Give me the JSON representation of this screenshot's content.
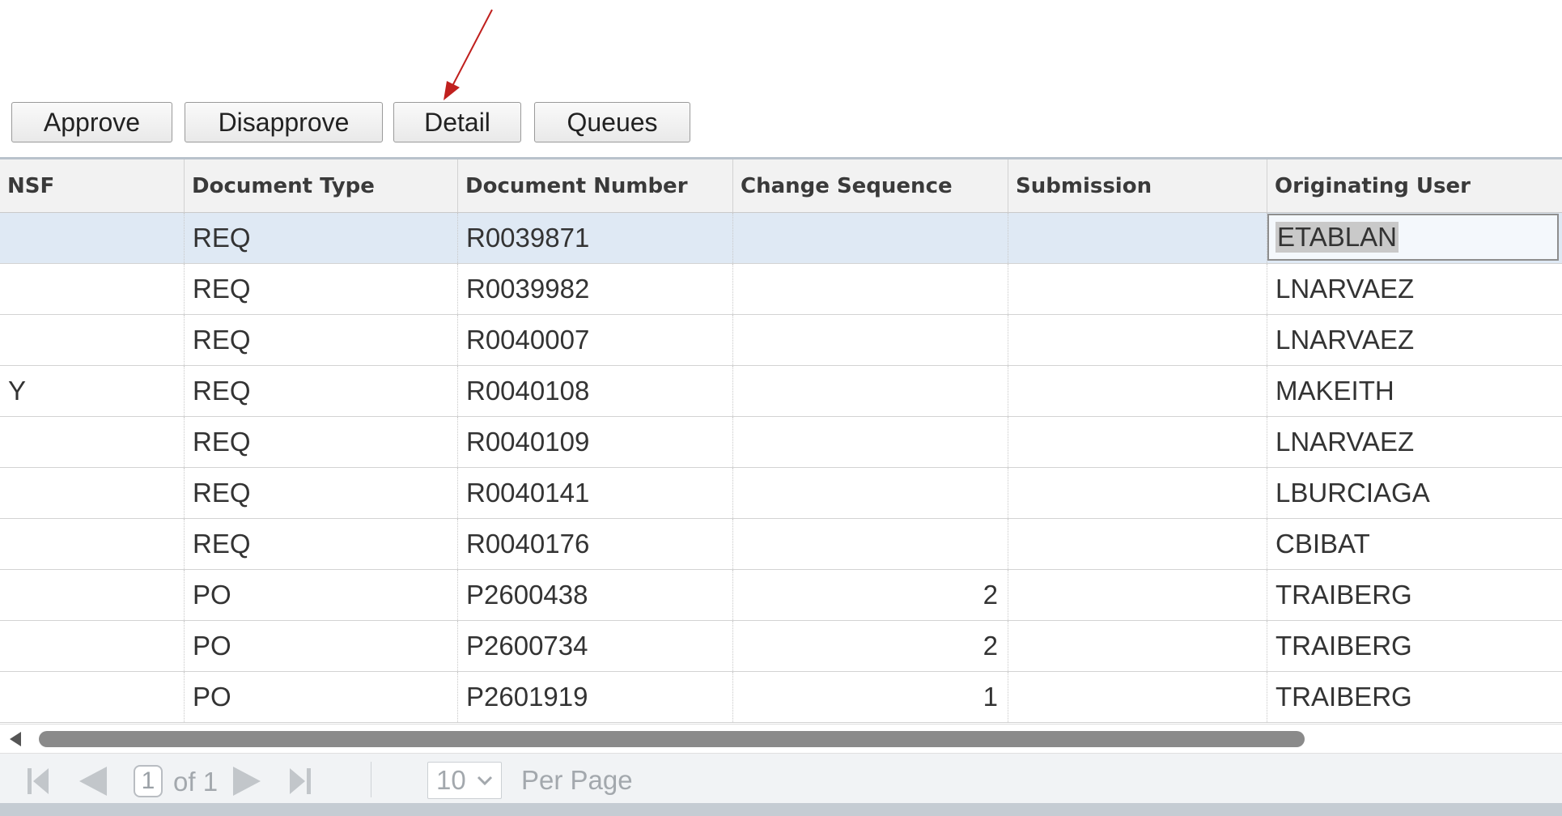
{
  "toolbar": {
    "buttons": [
      {
        "label": "Approve"
      },
      {
        "label": "Disapprove"
      },
      {
        "label": "Detail"
      },
      {
        "label": "Queues"
      }
    ]
  },
  "grid": {
    "columns": [
      "NSF",
      "Document Type",
      "Document Number",
      "Change Sequence",
      "Submission",
      "Originating User"
    ],
    "rows": [
      {
        "nsf": "",
        "doc_type": "REQ",
        "doc_number": "R0039871",
        "change_seq": "",
        "submission": "",
        "user": "ETABLAN",
        "selected": true
      },
      {
        "nsf": "",
        "doc_type": "REQ",
        "doc_number": "R0039982",
        "change_seq": "",
        "submission": "",
        "user": "LNARVAEZ"
      },
      {
        "nsf": "",
        "doc_type": "REQ",
        "doc_number": "R0040007",
        "change_seq": "",
        "submission": "",
        "user": "LNARVAEZ"
      },
      {
        "nsf": "Y",
        "doc_type": "REQ",
        "doc_number": "R0040108",
        "change_seq": "",
        "submission": "",
        "user": "MAKEITH"
      },
      {
        "nsf": "",
        "doc_type": "REQ",
        "doc_number": "R0040109",
        "change_seq": "",
        "submission": "",
        "user": "LNARVAEZ"
      },
      {
        "nsf": "",
        "doc_type": "REQ",
        "doc_number": "R0040141",
        "change_seq": "",
        "submission": "",
        "user": "LBURCIAGA"
      },
      {
        "nsf": "",
        "doc_type": "REQ",
        "doc_number": "R0040176",
        "change_seq": "",
        "submission": "",
        "user": "CBIBAT"
      },
      {
        "nsf": "",
        "doc_type": "PO",
        "doc_number": "P2600438",
        "change_seq": "2",
        "submission": "",
        "user": "TRAIBERG"
      },
      {
        "nsf": "",
        "doc_type": "PO",
        "doc_number": "P2600734",
        "change_seq": "2",
        "submission": "",
        "user": "TRAIBERG"
      },
      {
        "nsf": "",
        "doc_type": "PO",
        "doc_number": "P2601919",
        "change_seq": "1",
        "submission": "",
        "user": "TRAIBERG"
      }
    ]
  },
  "pager": {
    "current_page": "1",
    "of_text": "of 1",
    "per_page_value": "10",
    "per_page_label": "Per Page"
  },
  "colors": {
    "selected_row": "#dfe9f4",
    "annotation_arrow": "#c0201e"
  },
  "icons": {
    "first": "first-page-icon",
    "prev": "previous-page-icon",
    "next": "next-page-icon",
    "last": "last-page-icon",
    "scroll_left": "scroll-left-arrow-icon",
    "dropdown": "chevron-down-icon"
  }
}
